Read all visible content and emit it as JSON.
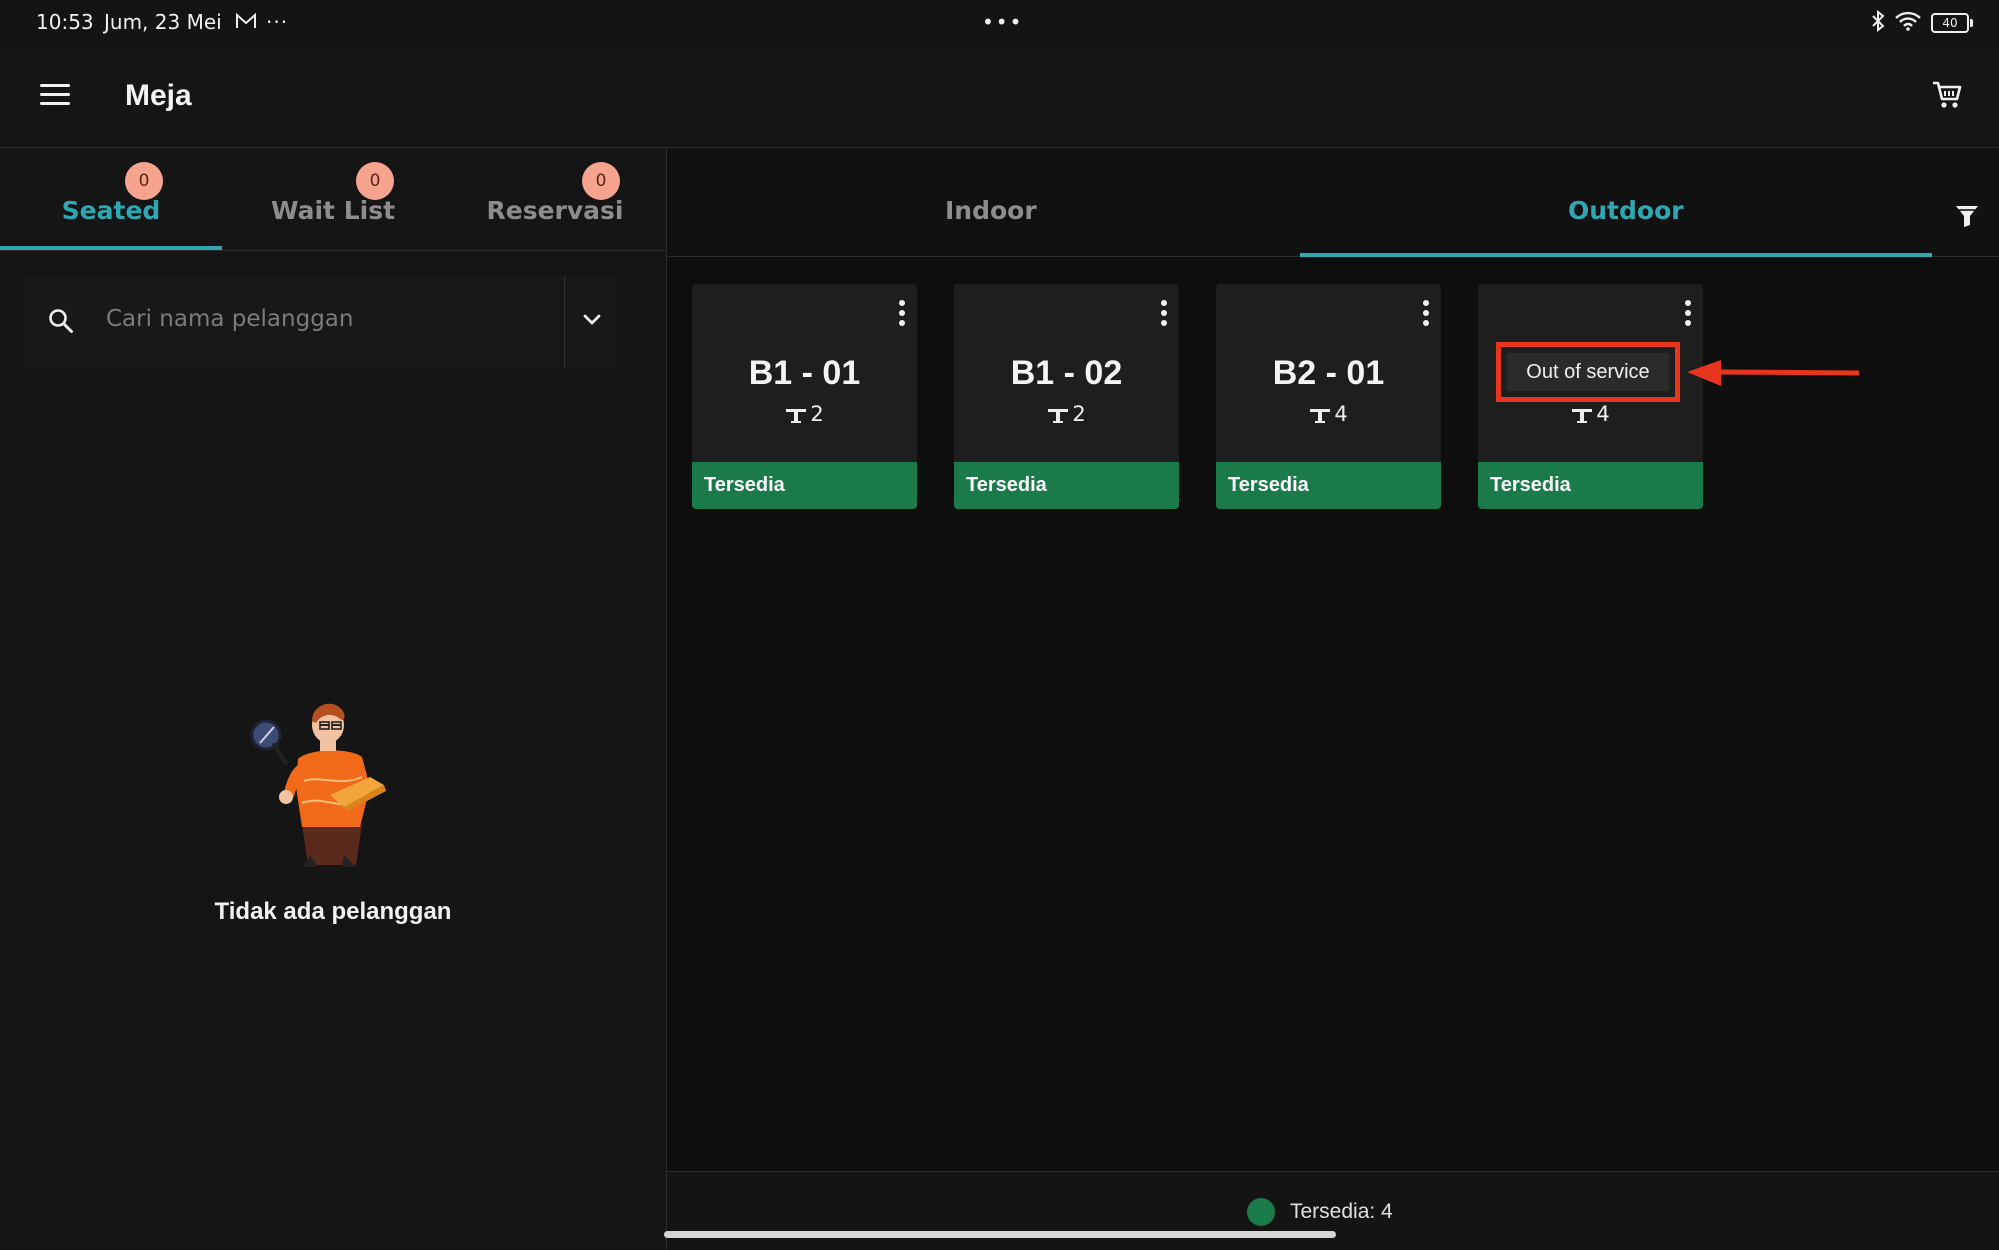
{
  "status_bar": {
    "time": "10:53",
    "date": "Jum, 23 Mei",
    "more": "···",
    "center_dots": "•••",
    "battery": "40"
  },
  "app_bar": {
    "title": "Meja"
  },
  "left_tabs": [
    {
      "label": "Seated",
      "badge": "0",
      "active": true
    },
    {
      "label": "Wait List",
      "badge": "0",
      "active": false
    },
    {
      "label": "Reservasi",
      "badge": "0",
      "active": false
    }
  ],
  "search": {
    "placeholder": "Cari nama pelanggan"
  },
  "empty_state": {
    "text": "Tidak ada pelanggan"
  },
  "right_tabs": [
    {
      "label": "Indoor",
      "active": false
    },
    {
      "label": "Outdoor",
      "active": true
    }
  ],
  "tables": [
    {
      "name": "B1 - 01",
      "capacity": "2",
      "status": "Tersedia"
    },
    {
      "name": "B1 - 02",
      "capacity": "2",
      "status": "Tersedia"
    },
    {
      "name": "B2 - 01",
      "capacity": "4",
      "status": "Tersedia"
    },
    {
      "name": "",
      "capacity": "4",
      "status": "Tersedia"
    }
  ],
  "tooltip": {
    "text": "Out of service"
  },
  "legend": {
    "text": "Tersedia: 4"
  },
  "colors": {
    "accent": "#2fa7b3",
    "available": "#1a7a4a",
    "badge": "#f6a48f",
    "highlight": "#e8361e"
  },
  "icons": [
    "menu-icon",
    "cart-icon",
    "search-icon",
    "chevron-down-icon",
    "filter-icon",
    "kebab-icon",
    "table-capacity-icon",
    "mail-icon",
    "bluetooth-icon",
    "wifi-icon",
    "battery-icon"
  ]
}
